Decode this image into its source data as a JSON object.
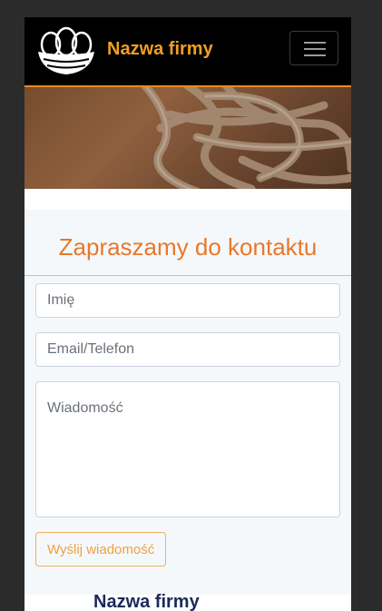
{
  "navbar": {
    "brand_name": "Nazwa firmy",
    "logo_icon": "egg-basket-logo-icon",
    "menu_icon": "hamburger-menu-icon"
  },
  "contact": {
    "title": "Zapraszamy do kontaktu",
    "name_placeholder": "Imię",
    "contact_placeholder": "Email/Telefon",
    "message_placeholder": "Wiadomość",
    "send_label": "Wyślij wiadomość"
  },
  "footer_peek": {
    "text": "Nazwa firmy"
  },
  "colors": {
    "accent": "#e8782a",
    "brand": "#f0a020",
    "navbar_bg": "#000000",
    "section_bg": "#f5f8fb"
  }
}
